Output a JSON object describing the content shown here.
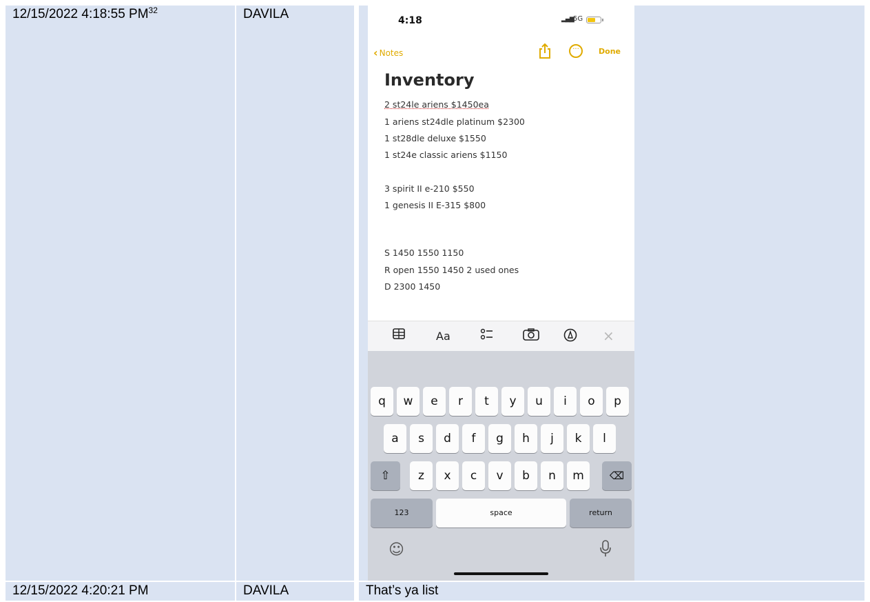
{
  "rows": [
    {
      "timestamp": "12/15/2022 4:18:55 PM",
      "footnote": "32",
      "sender": "DAVILA"
    },
    {
      "timestamp": "12/15/2022 4:20:21 PM",
      "sender": "DAVILA",
      "message": "That’s ya list"
    }
  ],
  "phone": {
    "time": "4:18",
    "network": "5G",
    "back_label": "Notes",
    "done_label": "Done",
    "note_title": "Inventory",
    "note_lines": [
      "2 st24le ariens $1450ea",
      "1 ariens st24dle platinum $2300",
      "1 st28dle deluxe $1550",
      "1 st24e classic ariens $1150",
      "3 spirit II e-210 $550",
      "1 genesis II E-315 $800",
      "S 1450 1550 1150",
      "R open 1550 1450 2 used ones",
      "D 2300 1450"
    ],
    "toolbar_icons": [
      "table-icon",
      "format-text-icon",
      "checklist-icon",
      "camera-icon",
      "markup-icon",
      "close-icon"
    ],
    "toolbar_format_label": "Aa",
    "keyboard": {
      "row1": [
        "q",
        "w",
        "e",
        "r",
        "t",
        "y",
        "u",
        "i",
        "o",
        "p"
      ],
      "row2": [
        "a",
        "s",
        "d",
        "f",
        "g",
        "h",
        "j",
        "k",
        "l"
      ],
      "row3": [
        "z",
        "x",
        "c",
        "v",
        "b",
        "n",
        "m"
      ],
      "numbers_key": "123",
      "space_key": "space",
      "return_key": "return"
    },
    "accent_color": "#e0ab00"
  }
}
